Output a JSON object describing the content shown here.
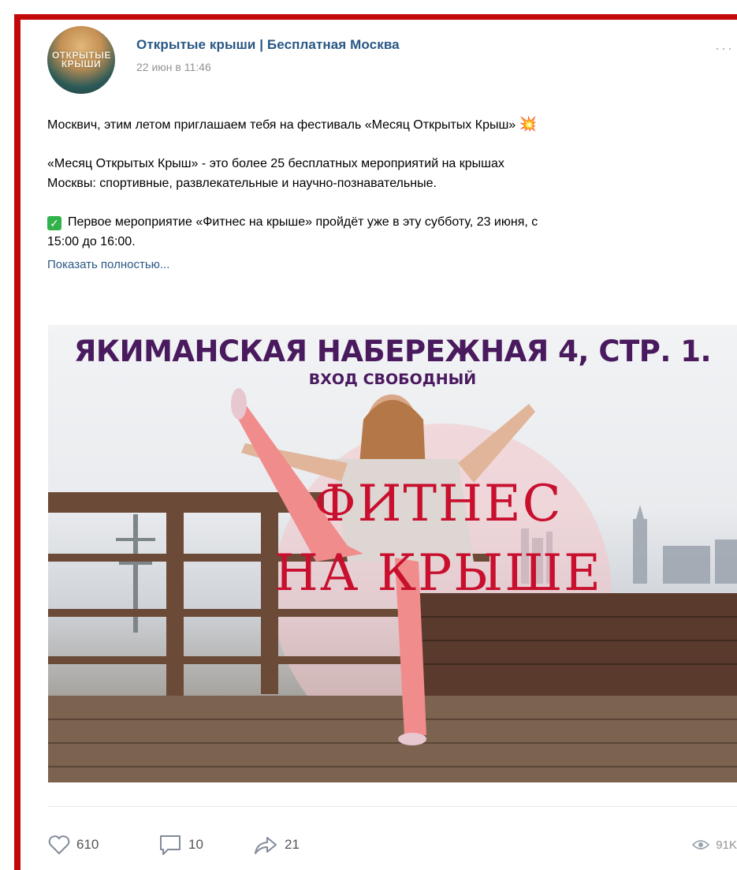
{
  "post": {
    "author": "Открытые крыши | Бесплатная Москва",
    "date": "22 июн в 11:46",
    "more": "···",
    "avatar_text": "ОТКРЫТЫЕ КРЫШИ",
    "text_lines": {
      "l1": "Москвич, этим летом приглашаем тебя на фестиваль «Месяц Открытых Крыш»",
      "l2": "«Месяц Открытых Крыш» - это более 25 бесплатных мероприятий на крышах",
      "l3": "Москвы: спортивные, развлекательные и научно-познавательные.",
      "l4": "Первое мероприятие «Фитнес на крыше» пройдёт уже в эту субботу, 23 июня, с",
      "l5": "15:00 до 16:00."
    },
    "emoji_boom": "💥",
    "emoji_check": "✓",
    "show_more": "Показать полностью..."
  },
  "image": {
    "headline": "ЯКИМАНСКАЯ НАБЕРЕЖНАЯ 4, СТР. 1.",
    "subheadline": "ВХОД СВОБОДНЫЙ",
    "title_line1": "ФИТНЕС",
    "title_line2": "НА КРЫШЕ"
  },
  "actions": {
    "likes": "610",
    "comments": "10",
    "shares": "21",
    "views": "91K"
  },
  "colors": {
    "frame": "#c4090b",
    "link": "#2a5885",
    "meta": "#939393",
    "title_red": "#c8102e",
    "headline_purple": "#4a1a5e"
  },
  "icons": [
    "heart-icon",
    "comment-icon",
    "share-icon",
    "eye-icon",
    "more-icon",
    "check-icon",
    "boom-icon"
  ]
}
